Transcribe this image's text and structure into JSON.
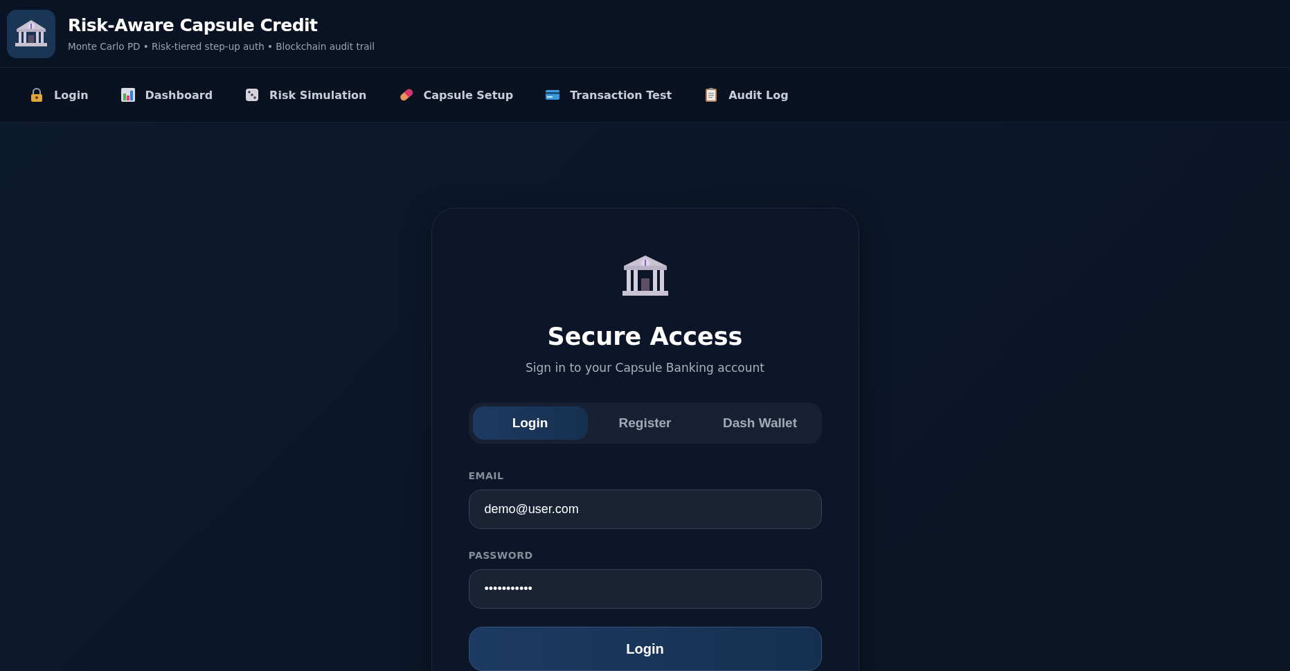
{
  "header": {
    "title": "Risk-Aware Capsule Credit",
    "subtitle": "Monte Carlo PD • Risk-tiered step-up auth • Blockchain audit trail"
  },
  "nav": [
    {
      "label": "Login"
    },
    {
      "label": "Dashboard"
    },
    {
      "label": "Risk Simulation"
    },
    {
      "label": "Capsule Setup"
    },
    {
      "label": "Transaction Test"
    },
    {
      "label": "Audit Log"
    }
  ],
  "card": {
    "title": "Secure Access",
    "subtitle": "Sign in to your Capsule Banking account",
    "tabs": [
      {
        "label": "Login",
        "selected": true
      },
      {
        "label": "Register",
        "selected": false
      },
      {
        "label": "Dash Wallet",
        "selected": false
      }
    ],
    "fields": [
      {
        "label": "EMAIL",
        "value": "demo@user.com"
      },
      {
        "label": "PASSWORD",
        "value": "•••••••••••"
      }
    ],
    "submit": "Login"
  }
}
